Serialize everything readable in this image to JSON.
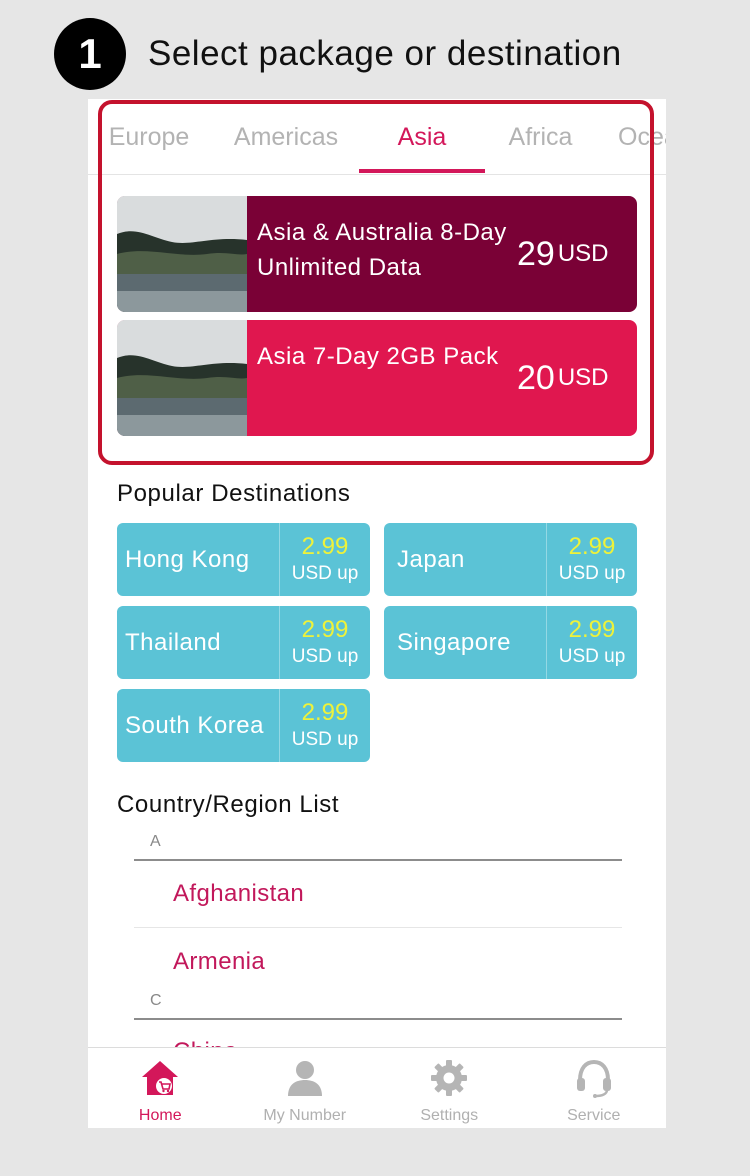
{
  "step": {
    "number": "1",
    "title": "Select package or destination"
  },
  "tabs": [
    {
      "label": "Europe"
    },
    {
      "label": "Americas"
    },
    {
      "label": "Asia"
    },
    {
      "label": "Africa"
    },
    {
      "label": "Oceania"
    }
  ],
  "active_tab": "Asia",
  "packages": [
    {
      "title": "Asia & Australia 8-Day Unlimited Data",
      "price": "29",
      "currency": "USD",
      "color": "#7a0136"
    },
    {
      "title": "Asia 7-Day 2GB Pack",
      "price": "20",
      "currency": "USD",
      "color": "#e0174f"
    }
  ],
  "popular": {
    "title": "Popular Destinations",
    "items": [
      {
        "name": "Hong Kong",
        "price": "2.99",
        "unit": "USD up"
      },
      {
        "name": "Japan",
        "price": "2.99",
        "unit": "USD up"
      },
      {
        "name": "Thailand",
        "price": "2.99",
        "unit": "USD up"
      },
      {
        "name": "Singapore",
        "price": "2.99",
        "unit": "USD up"
      },
      {
        "name": "South Korea",
        "price": "2.99",
        "unit": "USD up"
      }
    ]
  },
  "country_list": {
    "title": "Country/Region List",
    "groups": [
      {
        "letter": "A",
        "countries": [
          "Afghanistan",
          "Armenia"
        ]
      },
      {
        "letter": "C",
        "countries": [
          "China"
        ]
      }
    ]
  },
  "bottom_nav": [
    {
      "label": "Home",
      "icon": "home-cart-icon"
    },
    {
      "label": "My Number",
      "icon": "person-icon"
    },
    {
      "label": "Settings",
      "icon": "gear-icon"
    },
    {
      "label": "Service",
      "icon": "headset-icon"
    }
  ],
  "colors": {
    "accent": "#d3175a",
    "highlight": "#c4122d",
    "destination": "#5bc3d6",
    "price_yellow": "#eef23a"
  }
}
